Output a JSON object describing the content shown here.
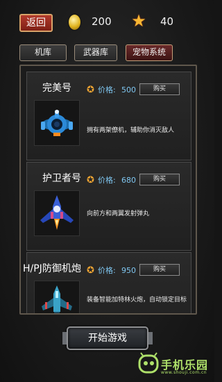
{
  "topbar": {
    "back_label": "返回",
    "coin_icon": "gold-coin-icon",
    "coins": "200",
    "star_icon": "star-medal-icon",
    "stars": "40"
  },
  "tabs": [
    {
      "label": "机库",
      "active": false
    },
    {
      "label": "武器库",
      "active": false
    },
    {
      "label": "宠物系统",
      "active": true
    }
  ],
  "items": [
    {
      "name": "完美号",
      "price_icon": "medal-icon",
      "price_label": "价格:",
      "price": "500",
      "buy_label": "购买",
      "desc": "拥有两架僚机，辅助你消灭敌人"
    },
    {
      "name": "护卫者号",
      "price_icon": "medal-icon",
      "price_label": "价格:",
      "price": "680",
      "buy_label": "购买",
      "desc": "向前方和两翼发射弹丸"
    },
    {
      "name": "H/PJ防御机炮",
      "price_icon": "medal-icon",
      "price_label": "价格:",
      "price": "950",
      "buy_label": "购买",
      "desc": "装备智能加特林火炮，自动锁定目标"
    }
  ],
  "start_label": "开始游戏",
  "watermark": {
    "text": "手机乐园",
    "url": "www.shouji.com.cn"
  },
  "colors": {
    "accent_price": "#7fc6f0",
    "back_button": "#b23a2c",
    "watermark": "#aee06a"
  }
}
